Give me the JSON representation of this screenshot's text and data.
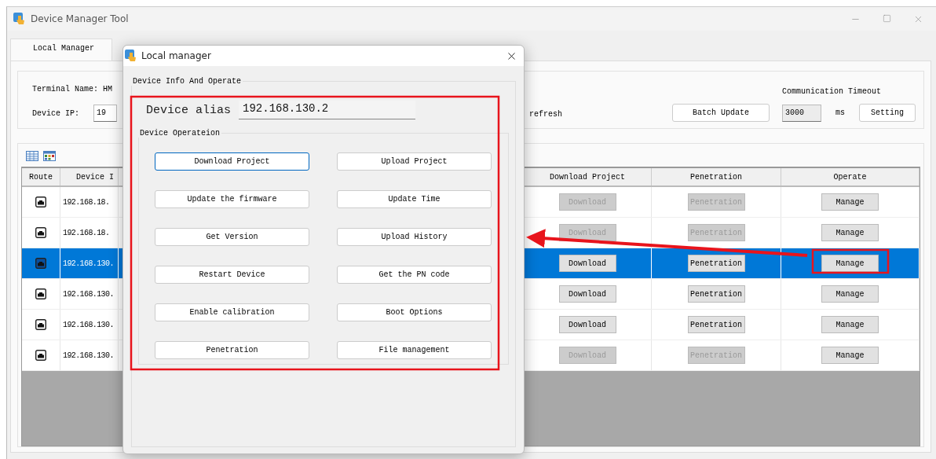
{
  "window": {
    "title": "Device Manager Tool"
  },
  "tabs": [
    {
      "label": "Local Manager",
      "selected": true
    }
  ],
  "terminal": {
    "label": "Terminal Name: HM"
  },
  "device_ip": {
    "label": "Device IP:",
    "value": "19"
  },
  "refresh": "refresh",
  "batch_update": "Batch Update",
  "timeout": {
    "label": "Communication Timeout",
    "value": "3000",
    "unit": "ms",
    "button": "Setting"
  },
  "table": {
    "columns": [
      "Route",
      "Device I",
      "Download Project",
      "Penetration",
      "Operate"
    ],
    "rows": [
      {
        "device_ip": "192.168.18.",
        "download": "Download",
        "penetration": "Penetration",
        "operate": "Manage",
        "disabled": true,
        "selected": false
      },
      {
        "device_ip": "192.168.18.",
        "download": "Download",
        "penetration": "Penetration",
        "operate": "Manage",
        "disabled": true,
        "selected": false
      },
      {
        "device_ip": "192.168.130.",
        "download": "Download",
        "penetration": "Penetration",
        "operate": "Manage",
        "disabled": false,
        "selected": true
      },
      {
        "device_ip": "192.168.130.",
        "download": "Download",
        "penetration": "Penetration",
        "operate": "Manage",
        "disabled": false,
        "selected": false
      },
      {
        "device_ip": "192.168.130.",
        "download": "Download",
        "penetration": "Penetration",
        "operate": "Manage",
        "disabled": false,
        "selected": false
      },
      {
        "device_ip": "192.168.130.",
        "download": "Download",
        "penetration": "Penetration",
        "operate": "Manage",
        "disabled": true,
        "selected": false
      }
    ]
  },
  "dialog": {
    "title": "Local manager",
    "group": "Device Info And Operate",
    "alias_label": "Device alias",
    "alias_value": "192.168.130.2",
    "operations_title": "Device Operateion",
    "buttons": [
      {
        "label": "Download Project",
        "focused": true
      },
      {
        "label": "Upload Project",
        "focused": false
      },
      {
        "label": "Update the firmware",
        "focused": false
      },
      {
        "label": "Update Time",
        "focused": false
      },
      {
        "label": "Get Version",
        "focused": false
      },
      {
        "label": "Upload History",
        "focused": false
      },
      {
        "label": "Restart Device",
        "focused": false
      },
      {
        "label": "Get the PN code",
        "focused": false
      },
      {
        "label": "Enable calibration",
        "focused": false
      },
      {
        "label": "Boot Options",
        "focused": false
      },
      {
        "label": "Penetration",
        "focused": false
      },
      {
        "label": "File management",
        "focused": false
      }
    ]
  }
}
